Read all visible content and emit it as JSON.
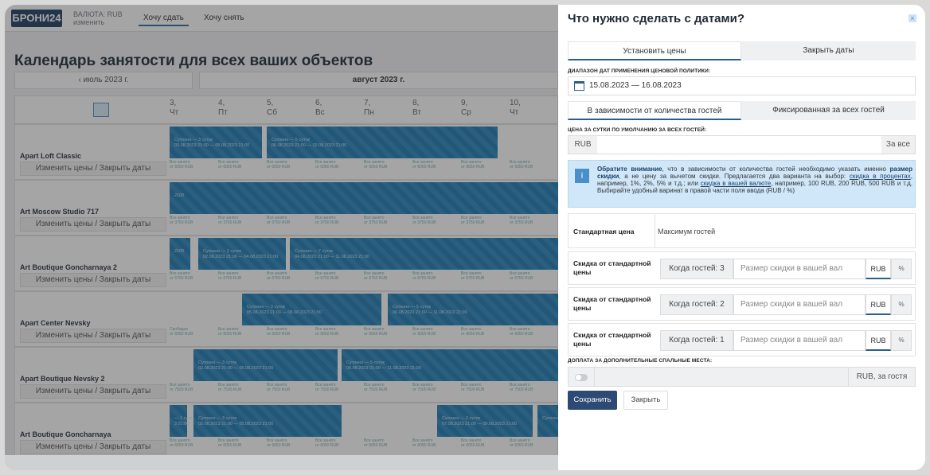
{
  "app": {
    "logo": "БРОНИ24",
    "currency_line1": "ВАЛЮТА: RUB",
    "currency_line2": "изменить",
    "tabs": [
      "Хочу сдать",
      "Хочу снять"
    ],
    "page_title": "Календарь занятости для всех ваших объектов",
    "month_prev": "‹  июль 2023 г.",
    "month_current": "август 2023 г.",
    "days": [
      {
        "num": "3,",
        "dow": "Чт"
      },
      {
        "num": "4,",
        "dow": "Пт"
      },
      {
        "num": "5,",
        "dow": "Сб"
      },
      {
        "num": "6,",
        "dow": "Вс"
      },
      {
        "num": "7,",
        "dow": "Пн"
      },
      {
        "num": "8,",
        "dow": "Вт"
      },
      {
        "num": "9,",
        "dow": "Ср"
      },
      {
        "num": "10,",
        "dow": "Чт"
      }
    ],
    "change_btn": "Изменить цены / Закрыть даты",
    "properties": [
      {
        "name": "Apart Loft Classic",
        "bars": [
          "Сутонно — 3 суток\n03.08.2023 21:00 — 05.08.2023 21:00",
          "Сутонно — 5 суток\n06.08.2023 21:00 — 10.08.2023 21:00"
        ],
        "cell_l1": "Все занято",
        "cell_l2": "от 6050 RUB"
      },
      {
        "name": "Art Moscow Studio 717",
        "bars": [
          "2100"
        ],
        "cell_l1": "Все занято",
        "cell_l2": "от 3750 RUB"
      },
      {
        "name": "Art Boutique Goncharnaya 2",
        "bars": [
          "2100",
          "Сутонно — 2 суток\n02.08.2023 21:00 — 04.08.2023 21:00",
          "Сутонно — 7 суток\n04.08.2023 21:00 — 11.08.2023 21:00"
        ],
        "cell_l1": "Все занято",
        "cell_l2": "от 6750 RUB"
      },
      {
        "name": "Apart Center Nevsky",
        "bars": [
          "Сутонно — 3 суток\n05.08.2023 21:00 — 08.08.2023 21:00",
          "Сутонно — 5 суток\n06.08.2023 21:00 — 11.08.2023 21:00"
        ],
        "cell_l1": "Все занято",
        "cell_l2": "от 6050 RUB"
      },
      {
        "name": "Apart Boutique Nevsky 2",
        "bars": [
          "Сутонно — 3 суток\n02.08.2023 21:00 — 05.08.2023 21:00",
          "Сутонно — 5 суток\n06.08.2023 21:00 — 11.08.2023 21:00"
        ],
        "cell_l1": "Все занято",
        "cell_l2": "от 7500 RUB"
      },
      {
        "name": "Art Boutique Goncharnaya",
        "bars": [
          "— 1 сутк\n3 21:00",
          "Сутонно — 3 суток\n02.08.2023 21:00 — 05.08.2023 21:00",
          "Сутонно — 2 суток\n07.08.2023 21:00 — 09.08.2023 21:00",
          "Сутонно"
        ],
        "cell_l1": "Все занято",
        "cell_l2": "от 6050 RUB"
      }
    ],
    "first_cell_labels": [
      "Все занято",
      "Все занято",
      "Все занято",
      "Свободно",
      "Все занято",
      "Все занято"
    ]
  },
  "panel": {
    "title": "Что нужно сделать с датами?",
    "close": "×",
    "mode_tabs": [
      "Установить цены",
      "Закрыть даты"
    ],
    "date_label": "ДИАПАЗОН ДАТ ПРИМЕНЕНИЯ ЦЕНОВОЙ ПОЛИТИКИ:",
    "date_value": "15.08.2023 — 16.08.2023",
    "guest_tabs": [
      "В зависимости от количества гостей",
      "Фиксированная за всех гостей"
    ],
    "price_label": "ЦЕНА ЗА СУТКИ ПО УМОЛЧАНИЮ ЗА ВСЕХ ГОСТЕЙ:",
    "price_currency": "RUB",
    "price_suffix": "За все",
    "info_bold1": "Обратите внимание",
    "info_t1": ", что в зависимости от количества гостей необходимо указать именно ",
    "info_bold2": "размер скидки",
    "info_t2": ", а не цену за вычетом скидки. Предлагается два варианта на выбор: ",
    "info_link1": "скидка в процентах",
    "info_t3": ", например, 1%, 2%, 5% и т.д.; или ",
    "info_link2": "скидка в вашей валюте",
    "info_t4": ", например, 100 RUB, 200 RUB, 500 RUB и т.д. Выбирайте удобный варинат в правой части поля ввода (RUB / %)",
    "standard_label": "Стандартная цена",
    "max_guests": "Максимум гостей",
    "discount_label": "Скидка от стандартной цены",
    "discounts": [
      {
        "when": "Когда гостей: 3",
        "placeholder": "Размер скидки в вашей вал"
      },
      {
        "when": "Когда гостей: 2",
        "placeholder": "Размер скидки в вашей вал"
      },
      {
        "when": "Когда гостей: 1",
        "placeholder": "Размер скидки в вашей вал"
      }
    ],
    "unit_rub": "RUB",
    "unit_pct": "%",
    "extra_label": "ДОПЛАТА ЗА ДОПОЛНИТЕЛЬНЫЕ СПАЛЬНЫЕ МЕСТА:",
    "extra_suffix": "RUB, за гостя",
    "save": "Сохранить",
    "cancel": "Закрыть"
  }
}
